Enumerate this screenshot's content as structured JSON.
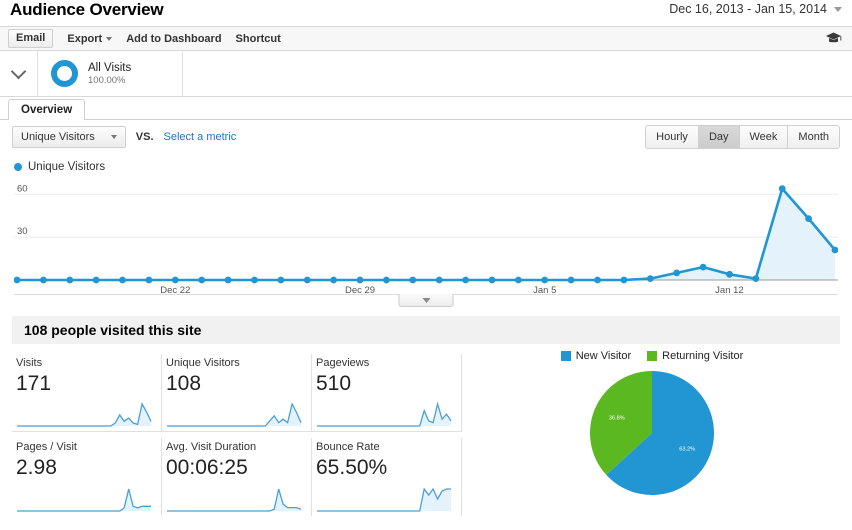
{
  "header": {
    "title": "Audience Overview",
    "date_range": "Dec 16, 2013 - Jan 15, 2014",
    "date_caret_icon": "chevron-down-icon"
  },
  "toolbar": {
    "email_label": "Email",
    "export_label": "Export",
    "add_to_dashboard_label": "Add to Dashboard",
    "shortcut_label": "Shortcut",
    "help_icon": "graduation-cap-icon"
  },
  "segment_bar": {
    "collapse_icon": "chevron-down-icon",
    "segment_name": "All Visits",
    "segment_percent": "100.00%",
    "segment_color": "#2196d3"
  },
  "tabs": [
    {
      "label": "Overview",
      "active": true
    }
  ],
  "metric_controls": {
    "primary_metric": "Unique Visitors",
    "primary_metric_caret_icon": "chevron-down-icon",
    "vs_label": "VS.",
    "select_metric_label": "Select a metric",
    "granularity": [
      {
        "label": "Hourly",
        "active": false
      },
      {
        "label": "Day",
        "active": true
      },
      {
        "label": "Week",
        "active": false
      },
      {
        "label": "Month",
        "active": false
      }
    ]
  },
  "chart_legend": {
    "series_label": "Unique Visitors",
    "series_color": "#2196d3"
  },
  "chart_handle_icon": "chevron-down-icon",
  "banner": {
    "headline": "108 people visited this site"
  },
  "kpis": [
    {
      "label": "Visits",
      "value": "171"
    },
    {
      "label": "Unique Visitors",
      "value": "108"
    },
    {
      "label": "Pageviews",
      "value": "510"
    },
    {
      "label": "Pages / Visit",
      "value": "2.98"
    },
    {
      "label": "Avg. Visit Duration",
      "value": "00:06:25"
    },
    {
      "label": "Bounce Rate",
      "value": "65.50%"
    }
  ],
  "chart_data": [
    {
      "type": "line",
      "title": "Unique Visitors",
      "xlabel": "",
      "ylabel": "Unique Visitors",
      "ylim": [
        0,
        70
      ],
      "yticks": [
        30,
        60
      ],
      "grid": true,
      "legend": "top-left",
      "x": [
        "Dec 16",
        "Dec 17",
        "Dec 18",
        "Dec 19",
        "Dec 20",
        "Dec 21",
        "Dec 22",
        "Dec 23",
        "Dec 24",
        "Dec 25",
        "Dec 26",
        "Dec 27",
        "Dec 28",
        "Dec 29",
        "Dec 30",
        "Dec 31",
        "Jan 1",
        "Jan 2",
        "Jan 3",
        "Jan 4",
        "Jan 5",
        "Jan 6",
        "Jan 7",
        "Jan 8",
        "Jan 9",
        "Jan 10",
        "Jan 11",
        "Jan 12",
        "Jan 13",
        "Jan 14",
        "Jan 15"
      ],
      "tick_labels": [
        "Dec 22",
        "Dec 29",
        "Jan 5",
        "Jan 12"
      ],
      "tick_label_index": [
        6,
        13,
        20,
        27
      ],
      "series": [
        {
          "name": "Unique Visitors",
          "color": "#2196d3",
          "values": [
            0,
            0,
            0,
            0,
            0,
            0,
            0,
            0,
            0,
            0,
            0,
            0,
            0,
            0,
            0,
            0,
            0,
            0,
            0,
            0,
            0,
            0,
            0,
            0,
            1,
            5,
            9,
            4,
            1,
            64,
            43,
            21
          ]
        }
      ]
    },
    {
      "type": "pie",
      "title": "",
      "legend": "top",
      "labels": [
        "New Visitor",
        "Returning Visitor"
      ],
      "values": [
        63.2,
        36.8
      ],
      "display_labels": [
        "63.2%",
        "36.8%"
      ],
      "colors": [
        "#2196d3",
        "#5bb821"
      ]
    },
    {
      "type": "line",
      "title": "Visits sparkline",
      "values": [
        0,
        0,
        0,
        0,
        0,
        0,
        0,
        0,
        0,
        0,
        0,
        0,
        0,
        0,
        0,
        0,
        0,
        0,
        0,
        0,
        0,
        0,
        2,
        7,
        3,
        5,
        2,
        1,
        14,
        9,
        3
      ]
    },
    {
      "type": "line",
      "title": "Unique Visitors sparkline",
      "values": [
        0,
        0,
        0,
        0,
        0,
        0,
        0,
        0,
        0,
        0,
        0,
        0,
        0,
        0,
        0,
        0,
        0,
        0,
        0,
        0,
        0,
        0,
        0,
        3,
        6,
        2,
        4,
        2,
        13,
        8,
        2
      ]
    },
    {
      "type": "line",
      "title": "Pageviews sparkline",
      "values": [
        0,
        0,
        0,
        0,
        0,
        0,
        0,
        0,
        0,
        0,
        0,
        0,
        0,
        0,
        0,
        0,
        0,
        0,
        0,
        0,
        0,
        0,
        0,
        0,
        9,
        3,
        2,
        13,
        4,
        7,
        3
      ]
    },
    {
      "type": "line",
      "title": "Pages / Visit sparkline",
      "values": [
        0,
        0,
        0,
        0,
        0,
        0,
        0,
        0,
        0,
        0,
        0,
        0,
        0,
        0,
        0,
        0,
        0,
        0,
        0,
        0,
        0,
        0,
        0,
        0,
        2,
        14,
        3,
        2,
        3,
        3,
        3
      ]
    },
    {
      "type": "line",
      "title": "Avg. Visit Duration sparkline",
      "values": [
        0,
        0,
        0,
        0,
        0,
        0,
        0,
        0,
        0,
        0,
        0,
        0,
        0,
        0,
        0,
        0,
        0,
        0,
        0,
        0,
        0,
        0,
        0,
        0,
        1,
        13,
        4,
        2,
        2,
        2,
        1
      ]
    },
    {
      "type": "line",
      "title": "Bounce Rate sparkline",
      "values": [
        0,
        0,
        0,
        0,
        0,
        0,
        0,
        0,
        0,
        0,
        0,
        0,
        0,
        0,
        0,
        0,
        0,
        0,
        0,
        0,
        0,
        0,
        0,
        0,
        11,
        8,
        11,
        6,
        10,
        11,
        11
      ]
    }
  ]
}
